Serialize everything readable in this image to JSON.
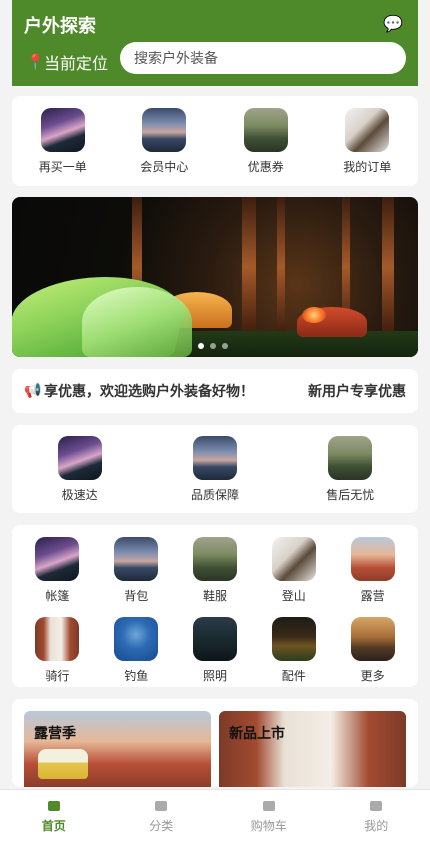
{
  "header": {
    "title": "户外探索",
    "location_label": "当前定位",
    "search_placeholder": "搜索户外装备"
  },
  "quick_entries": [
    {
      "label": "再买一单"
    },
    {
      "label": "会员中心"
    },
    {
      "label": "优惠券"
    },
    {
      "label": "我的订单"
    }
  ],
  "banner": {
    "slides_total": 3,
    "active_index": 0
  },
  "notice": {
    "text": "享优惠，欢迎选购户外装备好物！",
    "tag": "新用户专享优惠"
  },
  "services": [
    {
      "label": "极速达"
    },
    {
      "label": "品质保障"
    },
    {
      "label": "售后无忧"
    }
  ],
  "categories": [
    {
      "label": "帐篷"
    },
    {
      "label": "背包"
    },
    {
      "label": "鞋服"
    },
    {
      "label": "登山"
    },
    {
      "label": "露营"
    },
    {
      "label": "骑行"
    },
    {
      "label": "钓鱼"
    },
    {
      "label": "照明"
    },
    {
      "label": "配件"
    },
    {
      "label": "更多"
    }
  ],
  "promos": [
    {
      "title": "露营季"
    },
    {
      "title": "新品上市"
    }
  ],
  "tabbar": [
    {
      "label": "首页",
      "active": true
    },
    {
      "label": "分类",
      "active": false
    },
    {
      "label": "购物车",
      "active": false
    },
    {
      "label": "我的",
      "active": false
    }
  ],
  "colors": {
    "brand_green": "#4f8a2a",
    "background": "#f3f3f3",
    "tab_inactive": "#999999"
  }
}
